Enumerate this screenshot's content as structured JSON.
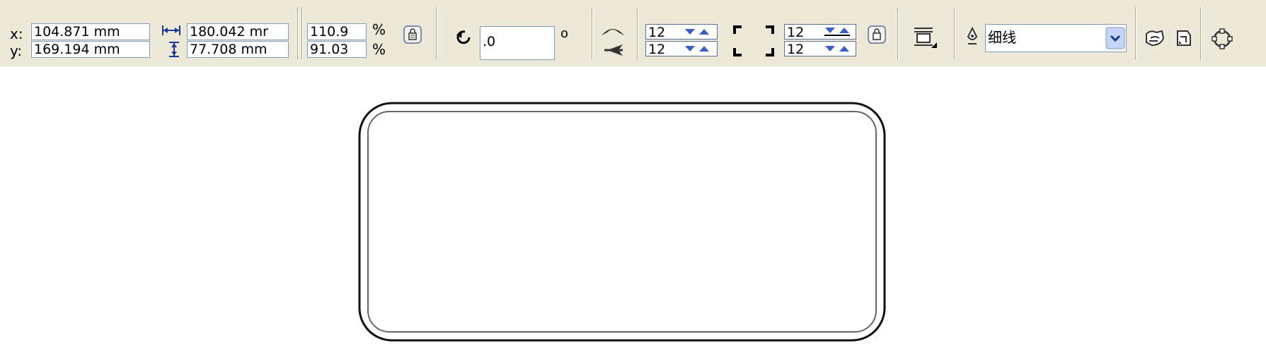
{
  "position": {
    "x_label": "x:",
    "x_value": "104.871 mm",
    "y_label": "y:",
    "y_value": "169.194 mm"
  },
  "size": {
    "width_value": "180.042 mr",
    "height_value": "77.708 mm"
  },
  "scale": {
    "x_value": "110.9",
    "y_value": "91.03",
    "x_unit": "%",
    "y_unit": "%"
  },
  "rotation": {
    "value": ".0",
    "unit": "o"
  },
  "corners": {
    "top_left": "12",
    "bottom_left": "12",
    "top_right": "12",
    "bottom_right": "12"
  },
  "outline": {
    "value": "细线"
  },
  "colors": {
    "toolbar_bg": "#ece9d8",
    "field_border": "#7f9db9",
    "spin_arrow": "#3a5fcd",
    "shape_outline": "#000000"
  }
}
